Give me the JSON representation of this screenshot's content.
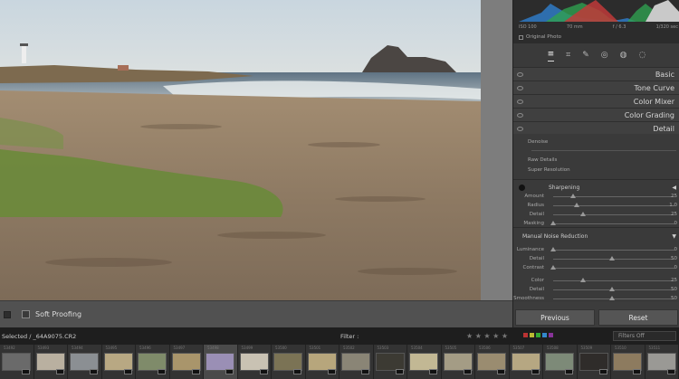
{
  "photo": {
    "subject": "beach-with-lighthouse-and-sea-stack"
  },
  "toolbar": {
    "soft_proofing_label": "Soft Proofing",
    "soft_proofing_checked": false
  },
  "histogram": {
    "iso": "ISO 100",
    "focal": "70 mm",
    "aperture": "f / 6.3",
    "shutter": "1/320 sec",
    "original_photo_label": "Original Photo"
  },
  "tool_strip": {
    "icons": [
      "sliders-icon",
      "crop-icon",
      "heal-icon",
      "redeye-icon",
      "masking-icon",
      "effects-icon"
    ]
  },
  "sections": [
    {
      "title": "Basic"
    },
    {
      "title": "Tone Curve"
    },
    {
      "title": "Color Mixer"
    },
    {
      "title": "Color Grading"
    },
    {
      "title": "Detail"
    }
  ],
  "detail": {
    "denoise_label": "Denoise",
    "raw_details_label": "Raw Details",
    "super_resolution_label": "Super Resolution",
    "sharpening_label": "Sharpening",
    "sharpening": [
      {
        "label": "Amount",
        "value": "25",
        "fraction": 0.17
      },
      {
        "label": "Radius",
        "value": "1.0",
        "fraction": 0.2
      },
      {
        "label": "Detail",
        "value": "25",
        "fraction": 0.25
      },
      {
        "label": "Masking",
        "value": "0",
        "fraction": 0.0
      }
    ],
    "noise_label": "Manual Noise Reduction",
    "luminance": [
      {
        "label": "Luminance",
        "value": "0",
        "fraction": 0.0
      },
      {
        "label": "Detail",
        "value": "50",
        "fraction": 0.5
      },
      {
        "label": "Contrast",
        "value": "0",
        "fraction": 0.0
      }
    ],
    "color": [
      {
        "label": "Color",
        "value": "25",
        "fraction": 0.25
      },
      {
        "label": "Detail",
        "value": "50",
        "fraction": 0.5
      },
      {
        "label": "Smoothness",
        "value": "50",
        "fraction": 0.5
      }
    ]
  },
  "buttons": {
    "previous": "Previous",
    "reset": "Reset"
  },
  "filmstrip": {
    "selected_label": "Selected / _64A9075.CR2",
    "filter_label": "Filter :",
    "filters_off": "Filters Off",
    "stars": "★ ★ ★ ★ ★",
    "label_colors": [
      "#b33",
      "#bb3",
      "#3a3",
      "#38c",
      "#839"
    ],
    "thumbs": [
      {
        "n": "53492",
        "c": "#6a6a6a"
      },
      {
        "n": "53493",
        "c": "#b9b0a0"
      },
      {
        "n": "53494",
        "c": "#8b8f93"
      },
      {
        "n": "53495",
        "c": "#b8a883"
      },
      {
        "n": "53496",
        "c": "#7f8b6a"
      },
      {
        "n": "53497",
        "c": "#a9956b"
      },
      {
        "n": "53498",
        "c": "#9a8fb5"
      },
      {
        "n": "53499",
        "c": "#c9c2b3"
      },
      {
        "n": "53500",
        "c": "#7b7355"
      },
      {
        "n": "53501",
        "c": "#b7a67c"
      },
      {
        "n": "53502",
        "c": "#8a8576"
      },
      {
        "n": "53503",
        "c": "#3c3a33"
      },
      {
        "n": "53504",
        "c": "#c2b894"
      },
      {
        "n": "53505",
        "c": "#a49c85"
      },
      {
        "n": "53506",
        "c": "#9a8c70"
      },
      {
        "n": "53507",
        "c": "#b6a782"
      },
      {
        "n": "53508",
        "c": "#7d8a78"
      },
      {
        "n": "53509",
        "c": "#2f2c2a"
      },
      {
        "n": "53510",
        "c": "#8d7b5f"
      },
      {
        "n": "53511",
        "c": "#9a9995"
      }
    ]
  }
}
